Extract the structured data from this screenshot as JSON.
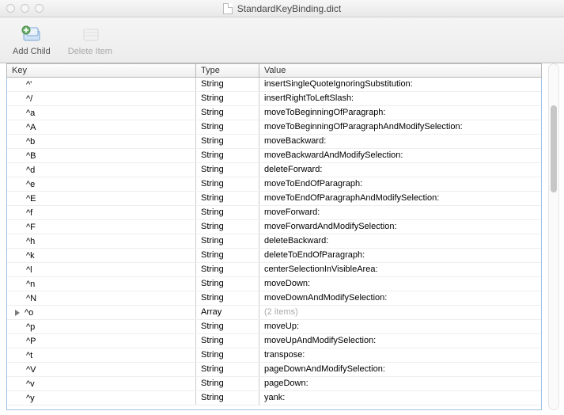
{
  "window": {
    "title": "StandardKeyBinding.dict"
  },
  "toolbar": {
    "add_child": "Add Child",
    "delete_item": "Delete Item"
  },
  "columns": {
    "key": "Key",
    "type": "Type",
    "value": "Value"
  },
  "rows": [
    {
      "key": "^'",
      "type": "String",
      "value": "insertSingleQuoteIgnoringSubstitution:",
      "expandable": false
    },
    {
      "key": "^/",
      "type": "String",
      "value": "insertRightToLeftSlash:",
      "expandable": false
    },
    {
      "key": "^a",
      "type": "String",
      "value": "moveToBeginningOfParagraph:",
      "expandable": false
    },
    {
      "key": "^A",
      "type": "String",
      "value": "moveToBeginningOfParagraphAndModifySelection:",
      "expandable": false
    },
    {
      "key": "^b",
      "type": "String",
      "value": "moveBackward:",
      "expandable": false
    },
    {
      "key": "^B",
      "type": "String",
      "value": "moveBackwardAndModifySelection:",
      "expandable": false
    },
    {
      "key": "^d",
      "type": "String",
      "value": "deleteForward:",
      "expandable": false
    },
    {
      "key": "^e",
      "type": "String",
      "value": "moveToEndOfParagraph:",
      "expandable": false
    },
    {
      "key": "^E",
      "type": "String",
      "value": "moveToEndOfParagraphAndModifySelection:",
      "expandable": false
    },
    {
      "key": "^f",
      "type": "String",
      "value": "moveForward:",
      "expandable": false
    },
    {
      "key": "^F",
      "type": "String",
      "value": "moveForwardAndModifySelection:",
      "expandable": false
    },
    {
      "key": "^h",
      "type": "String",
      "value": "deleteBackward:",
      "expandable": false
    },
    {
      "key": "^k",
      "type": "String",
      "value": "deleteToEndOfParagraph:",
      "expandable": false
    },
    {
      "key": "^l",
      "type": "String",
      "value": "centerSelectionInVisibleArea:",
      "expandable": false
    },
    {
      "key": "^n",
      "type": "String",
      "value": "moveDown:",
      "expandable": false
    },
    {
      "key": "^N",
      "type": "String",
      "value": "moveDownAndModifySelection:",
      "expandable": false
    },
    {
      "key": "^o",
      "type": "Array",
      "value": "(2 items)",
      "expandable": true,
      "dim": true
    },
    {
      "key": "^p",
      "type": "String",
      "value": "moveUp:",
      "expandable": false
    },
    {
      "key": "^P",
      "type": "String",
      "value": "moveUpAndModifySelection:",
      "expandable": false
    },
    {
      "key": "^t",
      "type": "String",
      "value": "transpose:",
      "expandable": false
    },
    {
      "key": "^V",
      "type": "String",
      "value": "pageDownAndModifySelection:",
      "expandable": false
    },
    {
      "key": "^v",
      "type": "String",
      "value": "pageDown:",
      "expandable": false
    },
    {
      "key": "^y",
      "type": "String",
      "value": "yank:",
      "expandable": false
    }
  ]
}
